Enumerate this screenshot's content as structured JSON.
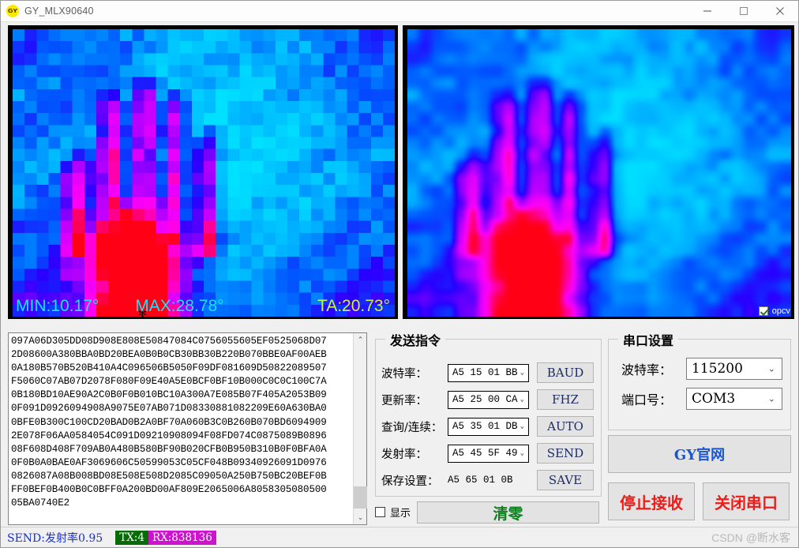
{
  "window": {
    "title": "GY_MLX90640",
    "icon": "gy-logo-icon",
    "minimize": "—",
    "maximize": "□",
    "close": "✕"
  },
  "thermal": {
    "left_view": {
      "min_label": "MIN:10.17°",
      "max_label": "MAX:28.78°",
      "ta_label": "TA:20.73°",
      "min_value": 10.17,
      "max_value": 28.78,
      "ambient_value": 20.73,
      "hot_marker": "✻",
      "grid_cols": 32,
      "grid_rows": 24,
      "colors": {
        "cold": "#00c8ff",
        "cool": "#0050ff",
        "mid": "#8000ff",
        "warm": "#ff00ff",
        "hot": "#ff0032",
        "hottest": "#ff0000"
      }
    },
    "right_view": {
      "opcv_label": "opcv",
      "opcv_checked": true
    }
  },
  "log": {
    "lines": [
      "097A06D305DD08D908E808E50847084C0756055605EF0525068D07",
      "2D08600A380BBA0BD20BEA0B0B0CB30BB30B220B070BBE0AF00AEB",
      "0A180B570B520B410A4C096506B5050F09DF081609D50822089507",
      "F5060C07AB07D2078F080F09E40A5E0BCF0BF10B000C0C0C100C7A",
      "0B180BD10AE90A2C0B0F0B010BC10A300A7E085B07F405A2053B09",
      "0F091D0926094908A9075E07AB071D08330881082209E60A630BA0",
      "0BFE0B300C100CD20BAD0B2A0BF70A060B3C0B260B070BD6094909",
      "2E078F06AA0584054C091D09210908094F08FD074C0875089B0896",
      "08F608D408F709AB0A480B580BF90B020CFB0B950B310B0F0BFA0A",
      "0F0B0A0BAE0AF3069606C50599053C05CF048B09340926091D0976",
      "0826087A08B008BD08E508E508D2085C09050A250B750BC20BEF0B",
      "FF0BEF0B400B0C0BFF0A200BD00AF809E2065006A8058305080500",
      "05BA0740E2"
    ],
    "scroll_up": "⌃",
    "scroll_down": "⌄"
  },
  "send_group": {
    "title": "发送指令",
    "rows": [
      {
        "label": "波特率：",
        "value": "A5 15 01 BB",
        "button": "BAUD"
      },
      {
        "label": "更新率：",
        "value": "A5 25 00 CA",
        "button": "FHZ"
      },
      {
        "label": "查询/连续：",
        "value": "A5 35 01 DB",
        "button": "AUTO"
      },
      {
        "label": "发射率：",
        "value": "A5 45 5F 49",
        "button": "SEND"
      }
    ],
    "save_row": {
      "label": "保存设置：",
      "value": "A5 65 01 0B",
      "button": "SAVE"
    },
    "chevron": "⌄"
  },
  "show_row": {
    "label": "显示",
    "checked": false
  },
  "clear_button": "清零",
  "port_group": {
    "title": "串口设置",
    "baud_label": "波特率：",
    "baud_value": "115200",
    "port_label": "端口号：",
    "port_value": "COM3",
    "chevron": "⌄"
  },
  "buttons": {
    "website": "GY官网",
    "stop_receive": "停止接收",
    "close_port": "关闭串口"
  },
  "status": {
    "send": "SEND:发射率0.95",
    "tx": "TX:4",
    "rx": "RX:838136"
  },
  "watermark": "CSDN @断水客"
}
